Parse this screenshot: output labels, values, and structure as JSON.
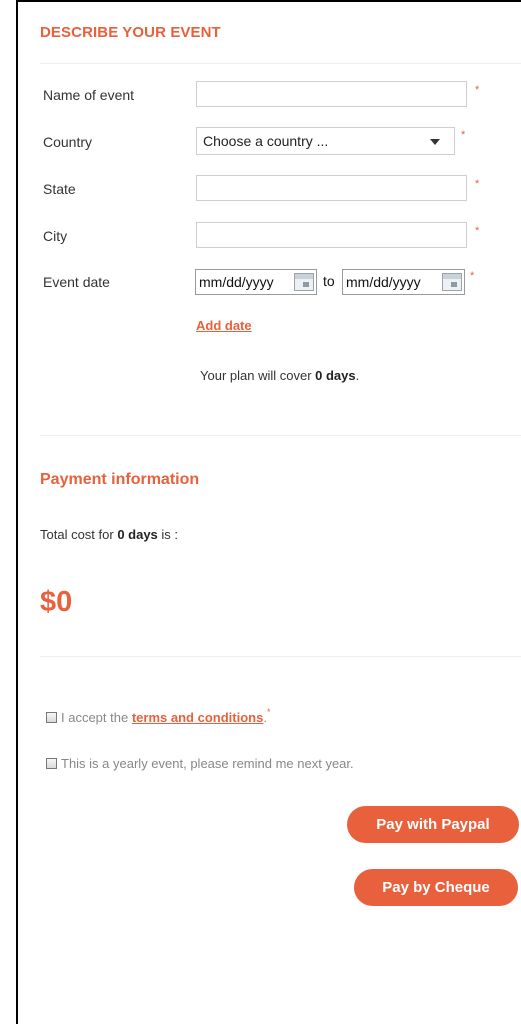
{
  "event": {
    "section_title": "DESCRIBE YOUR EVENT",
    "required_mark": "*",
    "fields": {
      "name_label": "Name of event",
      "name_value": "",
      "country_label": "Country",
      "country_value": "Choose a country ...",
      "state_label": "State",
      "state_value": "",
      "city_label": "City",
      "city_value": "",
      "date_label": "Event date",
      "date_from": "mm/dd/yyyy",
      "date_to_word": "to",
      "date_to": "mm/dd/yyyy"
    },
    "add_date_link": "Add date",
    "coverage": {
      "prefix": "Your plan will cover ",
      "days": "0 days",
      "suffix": "."
    }
  },
  "payment": {
    "title": "Payment information",
    "total_prefix": "Total cost for ",
    "total_days": "0 days",
    "total_suffix": " is :",
    "amount": "$0"
  },
  "checks": {
    "terms_prefix": "I accept the ",
    "terms_link": "terms and conditions",
    "terms_suffix": ".",
    "terms_required": "*",
    "yearly": "This is a yearly event, please remind me next year."
  },
  "buttons": {
    "paypal": "Pay with Paypal",
    "cheque": "Pay by Cheque"
  },
  "colors": {
    "accent": "#e8613c",
    "text": "#333333",
    "muted": "#888888"
  }
}
